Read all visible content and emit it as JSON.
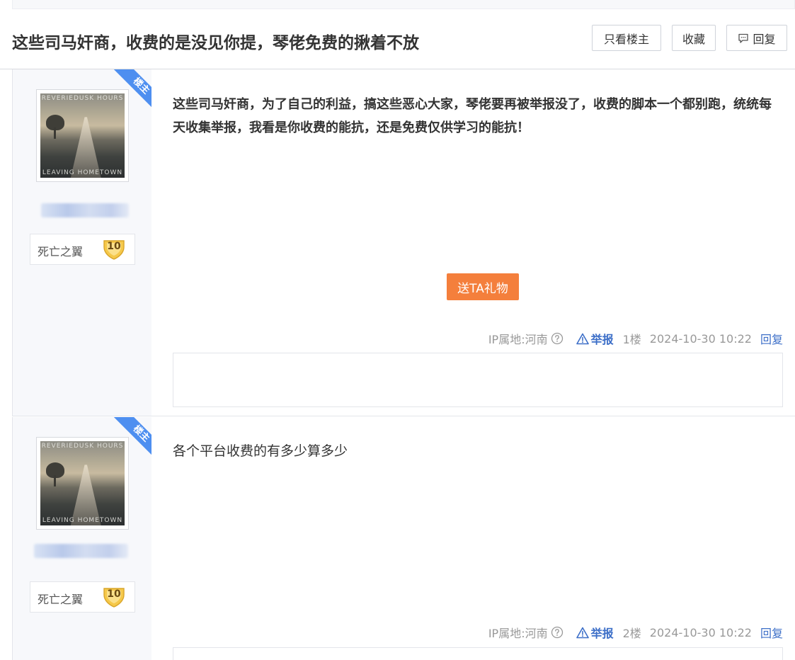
{
  "thread": {
    "title": "这些司马奸商，收费的是没见你提，琴佬免费的揪着不放",
    "buttons": {
      "only_author": "只看楼主",
      "favorite": "收藏",
      "reply": "回复"
    }
  },
  "author_badge": "楼主",
  "posts": [
    {
      "level_name": "死亡之翼",
      "level": "10",
      "content": "这些司马奸商，为了自己的利益，搞这些恶心大家，琴佬要再被举报没了，收费的脚本一个都别跑，统统每天收集举报，我看是你收费的能抗，还是免费仅供学习的能抗！",
      "gift_label": "送TA礼物",
      "ip": "IP属地:河南",
      "report": "举报",
      "floor": "1楼",
      "time": "2024-10-30 10:22",
      "reply": "回复"
    },
    {
      "level_name": "死亡之翼",
      "level": "10",
      "content": "各个平台收费的有多少算多少",
      "ip": "IP属地:河南",
      "report": "举报",
      "floor": "2楼",
      "time": "2024-10-30 10:22",
      "reply": "回复"
    }
  ],
  "colors": {
    "accent_blue": "#3d6fc8",
    "ribbon_blue": "#4e8ff0",
    "gift_orange": "#f47f3c",
    "badge_gold": "#f5c84a"
  },
  "icons": [
    "comment-icon",
    "help-circle-icon",
    "warning-icon",
    "level-shield-icon",
    "avatar-image"
  ]
}
